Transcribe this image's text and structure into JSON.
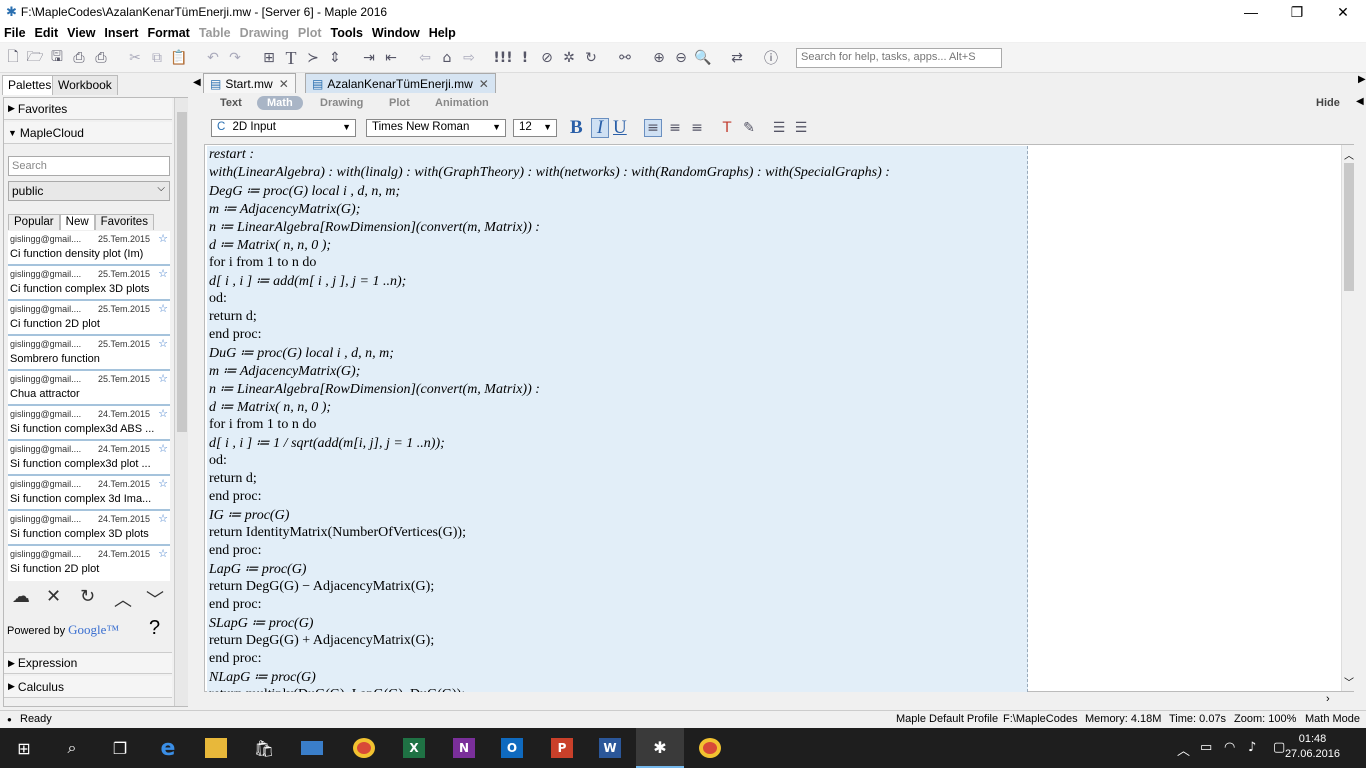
{
  "window": {
    "title": "F:\\MapleCodes\\AzalanKenarTümEnerji.mw - [Server 6] - Maple 2016",
    "minimize": "—",
    "maximize": "❐",
    "close": "✕"
  },
  "menu": {
    "items": [
      "File",
      "Edit",
      "View",
      "Insert",
      "Format",
      "Table",
      "Drawing",
      "Plot",
      "Tools",
      "Window",
      "Help"
    ],
    "disabled": [
      "Table",
      "Drawing",
      "Plot"
    ]
  },
  "toolbar": {
    "search_placeholder": "Search for help, tasks, apps... Alt+S"
  },
  "left_tabs": [
    "Palettes",
    "Workbook"
  ],
  "palettes": {
    "favorites": "Favorites",
    "maplecloud": "MapleCloud",
    "search_placeholder": "Search",
    "group_select": "public",
    "cloud_tabs": [
      "Popular",
      "New",
      "Favorites"
    ],
    "cloud_items": [
      {
        "user": "gislingg@gmail....",
        "date": "25.Tem.2015",
        "title": "Ci function  density plot (Im)"
      },
      {
        "user": "gislingg@gmail....",
        "date": "25.Tem.2015",
        "title": "Ci function  complex 3D plots"
      },
      {
        "user": "gislingg@gmail....",
        "date": "25.Tem.2015",
        "title": "Ci  function  2D plot"
      },
      {
        "user": "gislingg@gmail....",
        "date": "25.Tem.2015",
        "title": "Sombrero function"
      },
      {
        "user": "gislingg@gmail....",
        "date": "25.Tem.2015",
        "title": "Chua attractor"
      },
      {
        "user": "gislingg@gmail....",
        "date": "24.Tem.2015",
        "title": "Si function complex3d  ABS ..."
      },
      {
        "user": "gislingg@gmail....",
        "date": "24.Tem.2015",
        "title": "Si  function complex3d plot  ..."
      },
      {
        "user": "gislingg@gmail....",
        "date": "24.Tem.2015",
        "title": "Si function  complex 3d  Ima..."
      },
      {
        "user": "gislingg@gmail....",
        "date": "24.Tem.2015",
        "title": "Si function complex 3D plots"
      },
      {
        "user": "gislingg@gmail....",
        "date": "24.Tem.2015",
        "title": "Si function  2D plot"
      }
    ],
    "powered_by": "Powered by",
    "google": "Google™",
    "help_mark": "?",
    "expression": "Expression",
    "calculus": "Calculus"
  },
  "doc_tabs": [
    {
      "label": "Start.mw",
      "close": "✕"
    },
    {
      "label": "AzalanKenarTümEnerji.mw",
      "close": "✕"
    }
  ],
  "modes": [
    "Text",
    "Math",
    "Drawing",
    "Plot",
    "Animation"
  ],
  "mode_hide": "Hide",
  "format": {
    "input_mode": "2D Input",
    "font": "Times New Roman",
    "size": "12",
    "bold": "B",
    "italic": "I",
    "underline": "U"
  },
  "code_lines": [
    "restart :",
    "with(LinearAlgebra) : with(linalg) : with(GraphTheory) : with(networks) : with(RandomGraphs) : with(SpecialGraphs) :",
    "DegG ≔ proc(G) local i , d, n, m;",
    "m ≔ AdjacencyMatrix(G);",
    "n ≔ LinearAlgebra[RowDimension](convert(m, Matrix)) :",
    "d ≔ Matrix( n, n, 0 );",
    "for i from 1 to n do",
    "d[ i , i ] ≔  add(m[ i , j ], j = 1 ..n);",
    "od:",
    "return d;",
    "end proc:",
    "DuG ≔ proc(G) local i , d, n, m;",
    "m ≔ AdjacencyMatrix(G);",
    "n ≔ LinearAlgebra[RowDimension](convert(m, Matrix)) :",
    "d ≔ Matrix( n, n, 0 );",
    "for i from 1 to n do",
    "d[ i , i ]  ≔  1 / sqrt(add(m[i, j], j = 1 ..n));",
    "od:",
    "return d;",
    "end proc:",
    "IG ≔ proc(G)",
    "return IdentityMatrix(NumberOfVertices(G));",
    "end proc:",
    "LapG ≔ proc(G)",
    "return DegG(G) − AdjacencyMatrix(G);",
    "end proc:",
    "SLapG ≔ proc(G)",
    "return DegG(G)  +  AdjacencyMatrix(G);",
    "end proc:",
    "NLapG ≔ proc(G)",
    "return multiply(DuG(G), LapG(G), DuG(G));"
  ],
  "status": {
    "ready": "Ready",
    "profile": "Maple Default Profile",
    "path": "F:\\MapleCodes",
    "memory": "Memory: 4.18M",
    "time": "Time: 0.07s",
    "zoom": "Zoom: 100%",
    "mode": "Math Mode"
  },
  "taskbar": {
    "time": "01:48",
    "date": "27.06.2016"
  }
}
